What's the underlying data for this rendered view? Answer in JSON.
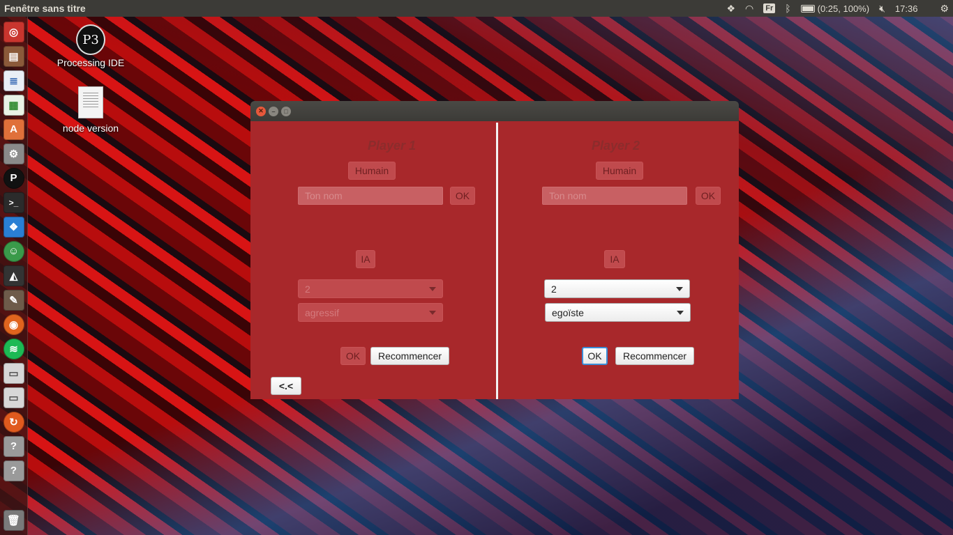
{
  "topbar": {
    "window_title": "Fenêtre sans titre",
    "keyboard_layout": "Fr",
    "battery": "(0:25, 100%)",
    "time": "17:36"
  },
  "launcher": {
    "items": [
      "ubuntu-dash-icon",
      "files-icon",
      "writer-icon",
      "calc-icon",
      "software-center-icon",
      "settings-icon",
      "processing-icon",
      "terminal-icon",
      "dropbox-icon",
      "android-icon",
      "unity-icon",
      "gimp-icon",
      "firefox-icon",
      "spotify-icon",
      "drive-icon",
      "drive2-icon",
      "update-icon",
      "unknown-icon",
      "unknown2-icon",
      "trash-icon"
    ]
  },
  "desktop": {
    "icons": [
      {
        "label": "Processing IDE"
      },
      {
        "label": "node version"
      }
    ]
  },
  "window": {
    "player1": {
      "title": "Player 1",
      "human_button": "Humain",
      "name_placeholder": "Ton nom",
      "name_ok": "OK",
      "ai_button": "IA",
      "level_value": "2",
      "strategy_value": "agressif",
      "ok_button": "OK",
      "restart_button": "Recommencer",
      "back_button": "<.<"
    },
    "player2": {
      "title": "Player 2",
      "human_button": "Humain",
      "name_placeholder": "Ton nom",
      "name_ok": "OK",
      "ai_button": "IA",
      "level_value": "2",
      "strategy_value": "egoïste",
      "ok_button": "OK",
      "restart_button": "Recommencer"
    }
  },
  "colors": {
    "panel_bg": "#a8282b",
    "topbar_bg": "#3c3b37",
    "focus_border": "#3b8ed8"
  }
}
